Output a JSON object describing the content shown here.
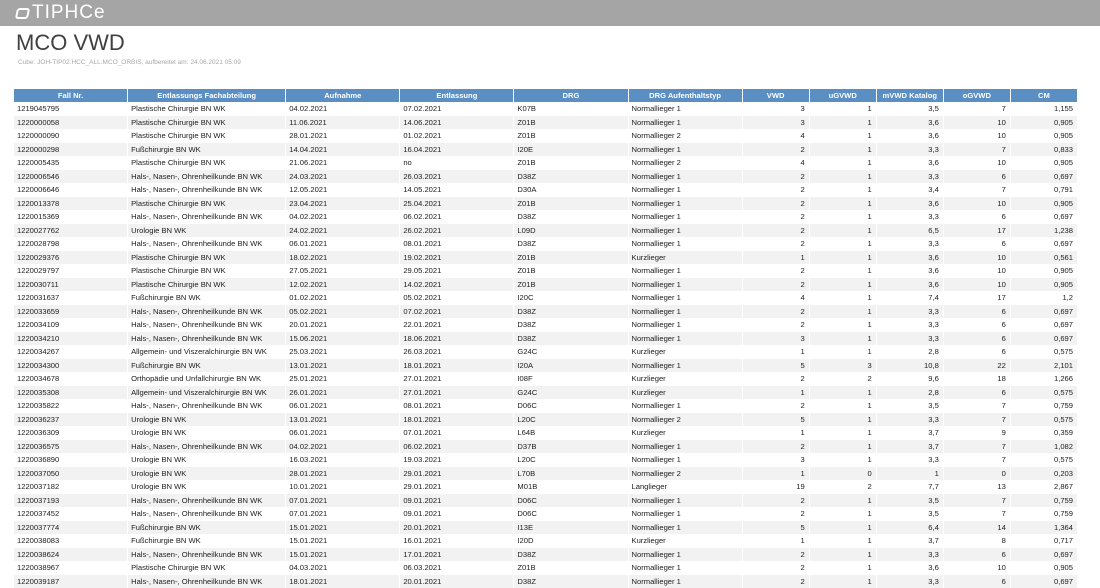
{
  "header": {
    "brand": "TIPHCe"
  },
  "page": {
    "title": "MCO VWD",
    "subtitle": "Cube: JOH-TIP02.HCC_ALL.MCO_ORBIS, aufbereitet am: 24.06.2021 05:09"
  },
  "table": {
    "columns": [
      "Fall Nr.",
      "Entlassungs Fachabteilung",
      "Aufnahme",
      "Entlassung",
      "DRG",
      "DRG Aufenthaltstyp",
      "VWD",
      "uGVWD",
      "mVWD Katalog",
      "oGVWD",
      "CM"
    ],
    "rows": [
      [
        "1219045795",
        "Plastische Chirurgie BN WK",
        "04.02.2021",
        "07.02.2021",
        "K07B",
        "Normallieger 1",
        "3",
        "1",
        "3,5",
        "7",
        "1,155"
      ],
      [
        "1220000058",
        "Plastische Chirurgie BN WK",
        "11.06.2021",
        "14.06.2021",
        "Z01B",
        "Normallieger 1",
        "3",
        "1",
        "3,6",
        "10",
        "0,905"
      ],
      [
        "1220000090",
        "Plastische Chirurgie BN WK",
        "28.01.2021",
        "01.02.2021",
        "Z01B",
        "Normallieger 2",
        "4",
        "1",
        "3,6",
        "10",
        "0,905"
      ],
      [
        "1220000298",
        "Fußchirurgie BN WK",
        "14.04.2021",
        "16.04.2021",
        "I20E",
        "Normallieger 1",
        "2",
        "1",
        "3,3",
        "7",
        "0,833"
      ],
      [
        "1220005435",
        "Plastische Chirurgie BN WK",
        "21.06.2021",
        "no",
        "Z01B",
        "Normallieger 2",
        "4",
        "1",
        "3,6",
        "10",
        "0,905"
      ],
      [
        "1220006546",
        "Hals-, Nasen-, Ohrenheilkunde BN WK",
        "24.03.2021",
        "26.03.2021",
        "D38Z",
        "Normallieger 1",
        "2",
        "1",
        "3,3",
        "6",
        "0,697"
      ],
      [
        "1220006646",
        "Hals-, Nasen-, Ohrenheilkunde BN WK",
        "12.05.2021",
        "14.05.2021",
        "D30A",
        "Normallieger 1",
        "2",
        "1",
        "3,4",
        "7",
        "0,791"
      ],
      [
        "1220013378",
        "Plastische Chirurgie BN WK",
        "23.04.2021",
        "25.04.2021",
        "Z01B",
        "Normallieger 1",
        "2",
        "1",
        "3,6",
        "10",
        "0,905"
      ],
      [
        "1220015369",
        "Hals-, Nasen-, Ohrenheilkunde BN WK",
        "04.02.2021",
        "06.02.2021",
        "D38Z",
        "Normallieger 1",
        "2",
        "1",
        "3,3",
        "6",
        "0,697"
      ],
      [
        "1220027762",
        "Urologie BN WK",
        "24.02.2021",
        "26.02.2021",
        "L09D",
        "Normallieger 1",
        "2",
        "1",
        "6,5",
        "17",
        "1,238"
      ],
      [
        "1220028798",
        "Hals-, Nasen-, Ohrenheilkunde BN WK",
        "06.01.2021",
        "08.01.2021",
        "D38Z",
        "Normallieger 1",
        "2",
        "1",
        "3,3",
        "6",
        "0,697"
      ],
      [
        "1220029376",
        "Plastische Chirurgie BN WK",
        "18.02.2021",
        "19.02.2021",
        "Z01B",
        "Kurzlieger",
        "1",
        "1",
        "3,6",
        "10",
        "0,561"
      ],
      [
        "1220029797",
        "Plastische Chirurgie BN WK",
        "27.05.2021",
        "29.05.2021",
        "Z01B",
        "Normallieger 1",
        "2",
        "1",
        "3,6",
        "10",
        "0,905"
      ],
      [
        "1220030711",
        "Plastische Chirurgie BN WK",
        "12.02.2021",
        "14.02.2021",
        "Z01B",
        "Normallieger 1",
        "2",
        "1",
        "3,6",
        "10",
        "0,905"
      ],
      [
        "1220031637",
        "Fußchirurgie BN WK",
        "01.02.2021",
        "05.02.2021",
        "I20C",
        "Normallieger 1",
        "4",
        "1",
        "7,4",
        "17",
        "1,2"
      ],
      [
        "1220033659",
        "Hals-, Nasen-, Ohrenheilkunde BN WK",
        "05.02.2021",
        "07.02.2021",
        "D38Z",
        "Normallieger 1",
        "2",
        "1",
        "3,3",
        "6",
        "0,697"
      ],
      [
        "1220034109",
        "Hals-, Nasen-, Ohrenheilkunde BN WK",
        "20.01.2021",
        "22.01.2021",
        "D38Z",
        "Normallieger 1",
        "2",
        "1",
        "3,3",
        "6",
        "0,697"
      ],
      [
        "1220034210",
        "Hals-, Nasen-, Ohrenheilkunde BN WK",
        "15.06.2021",
        "18.06.2021",
        "D38Z",
        "Normallieger 1",
        "3",
        "1",
        "3,3",
        "6",
        "0,697"
      ],
      [
        "1220034267",
        "Allgemein- und Viszeralchirurgie BN WK",
        "25.03.2021",
        "26.03.2021",
        "G24C",
        "Kurzlieger",
        "1",
        "1",
        "2,8",
        "6",
        "0,575"
      ],
      [
        "1220034300",
        "Fußchirurgie BN WK",
        "13.01.2021",
        "18.01.2021",
        "I20A",
        "Normallieger 1",
        "5",
        "3",
        "10,8",
        "22",
        "2,101"
      ],
      [
        "1220034678",
        "Orthopädie und Unfallchirurgie BN WK",
        "25.01.2021",
        "27.01.2021",
        "I08F",
        "Kurzlieger",
        "2",
        "2",
        "9,6",
        "18",
        "1,266"
      ],
      [
        "1220035308",
        "Allgemein- und Viszeralchirurgie BN WK",
        "26.01.2021",
        "27.01.2021",
        "G24C",
        "Kurzlieger",
        "1",
        "1",
        "2,8",
        "6",
        "0,575"
      ],
      [
        "1220035822",
        "Hals-, Nasen-, Ohrenheilkunde BN WK",
        "06.01.2021",
        "08.01.2021",
        "D06C",
        "Normallieger 1",
        "2",
        "1",
        "3,5",
        "7",
        "0,759"
      ],
      [
        "1220036237",
        "Urologie BN WK",
        "13.01.2021",
        "18.01.2021",
        "L20C",
        "Normallieger 2",
        "5",
        "1",
        "3,3",
        "7",
        "0,575"
      ],
      [
        "1220036309",
        "Urologie BN WK",
        "06.01.2021",
        "07.01.2021",
        "L64B",
        "Kurzlieger",
        "1",
        "1",
        "3,7",
        "9",
        "0,359"
      ],
      [
        "1220036575",
        "Hals-, Nasen-, Ohrenheilkunde BN WK",
        "04.02.2021",
        "06.02.2021",
        "D37B",
        "Normallieger 1",
        "2",
        "1",
        "3,7",
        "7",
        "1,082"
      ],
      [
        "1220036890",
        "Urologie BN WK",
        "16.03.2021",
        "19.03.2021",
        "L20C",
        "Normallieger 1",
        "3",
        "1",
        "3,3",
        "7",
        "0,575"
      ],
      [
        "1220037050",
        "Urologie BN WK",
        "28.01.2021",
        "29.01.2021",
        "L70B",
        "Normallieger 2",
        "1",
        "0",
        "1",
        "0",
        "0,203"
      ],
      [
        "1220037182",
        "Urologie BN WK",
        "10.01.2021",
        "29.01.2021",
        "M01B",
        "Langlieger",
        "19",
        "2",
        "7,7",
        "13",
        "2,867"
      ],
      [
        "1220037193",
        "Hals-, Nasen-, Ohrenheilkunde BN WK",
        "07.01.2021",
        "09.01.2021",
        "D06C",
        "Normallieger 1",
        "2",
        "1",
        "3,5",
        "7",
        "0,759"
      ],
      [
        "1220037452",
        "Hals-, Nasen-, Ohrenheilkunde BN WK",
        "07.01.2021",
        "09.01.2021",
        "D06C",
        "Normallieger 1",
        "2",
        "1",
        "3,5",
        "7",
        "0,759"
      ],
      [
        "1220037774",
        "Fußchirurgie BN WK",
        "15.01.2021",
        "20.01.2021",
        "I13E",
        "Normallieger 1",
        "5",
        "1",
        "6,4",
        "14",
        "1,364"
      ],
      [
        "1220038083",
        "Fußchirurgie BN WK",
        "15.01.2021",
        "16.01.2021",
        "I20D",
        "Kurzlieger",
        "1",
        "1",
        "3,7",
        "8",
        "0,717"
      ],
      [
        "1220038624",
        "Hals-, Nasen-, Ohrenheilkunde BN WK",
        "15.01.2021",
        "17.01.2021",
        "D38Z",
        "Normallieger 1",
        "2",
        "1",
        "3,3",
        "6",
        "0,697"
      ],
      [
        "1220038967",
        "Plastische Chirurgie BN WK",
        "04.03.2021",
        "06.03.2021",
        "Z01B",
        "Normallieger 1",
        "2",
        "1",
        "3,6",
        "10",
        "0,905"
      ],
      [
        "1220039187",
        "Hals-, Nasen-, Ohrenheilkunde BN WK",
        "18.01.2021",
        "20.01.2021",
        "D38Z",
        "Normallieger 1",
        "2",
        "1",
        "3,3",
        "6",
        "0,697"
      ]
    ]
  }
}
